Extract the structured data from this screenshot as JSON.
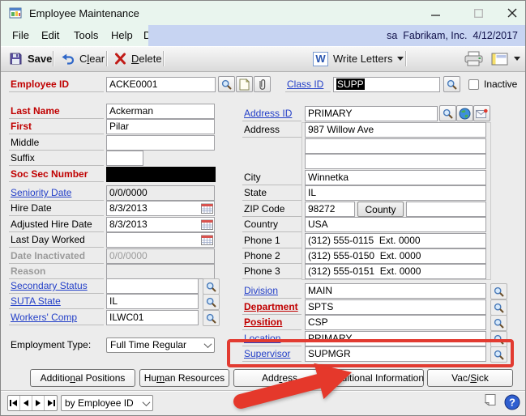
{
  "window": {
    "title": "Employee Maintenance"
  },
  "menubar": {
    "file": "File",
    "edit": "Edit",
    "tools": "Tools",
    "help": "Help",
    "debug": "Debug",
    "context": "sa  Fabrikam, Inc.  4/12/2017"
  },
  "toolbar": {
    "save": "Save",
    "clear_pre": "C",
    "clear_key": "l",
    "clear_post": "ear",
    "delete_pre": "",
    "delete_key": "D",
    "delete_post": "elete",
    "word_letter": "W",
    "write_letters": "Write Letters"
  },
  "header": {
    "employee_id_label": "Employee ID",
    "employee_id": "ACKE0001",
    "class_id_label": "Class ID",
    "class_id": "SUPP",
    "inactive_label": "Inactive"
  },
  "personal": {
    "last_name_label": "Last Name",
    "last_name": "Ackerman",
    "first_label": "First",
    "first": "Pilar",
    "middle_label": "Middle",
    "middle": "",
    "suffix_label": "Suffix",
    "suffix": "",
    "ssn_label": "Soc Sec Number"
  },
  "dates": {
    "seniority_label": "Seniority Date",
    "seniority": "0/0/0000",
    "hire_label": "Hire Date",
    "hire": "8/3/2013",
    "adjusted_label": "Adjusted Hire Date",
    "adjusted": "8/3/2013",
    "last_day_label": "Last Day Worked",
    "last_day": "",
    "inactivated_label": "Date Inactivated",
    "inactivated": "0/0/0000",
    "reason_label": "Reason",
    "reason": ""
  },
  "status": {
    "secondary_label": "Secondary Status",
    "secondary": "",
    "suta_label": "SUTA State",
    "suta": "IL",
    "workers_label": "Workers' Comp",
    "workers": "ILWC01",
    "employment_label": "Employment Type:",
    "employment": "Full Time Regular"
  },
  "address": {
    "address_id_label": "Address ID",
    "address_id": "PRIMARY",
    "address_label": "Address",
    "line1": "987 Willow Ave",
    "line2": "",
    "line3": "",
    "city_label": "City",
    "city": "Winnetka",
    "state_label": "State",
    "state": "IL",
    "zip_label": "ZIP Code",
    "zip": "98272",
    "county_button": "County",
    "county": "",
    "country_label": "Country",
    "country": "USA",
    "phone1_label": "Phone 1",
    "phone1": "(312) 555-0115  Ext. 0000",
    "phone2_label": "Phone 2",
    "phone2": "(312) 555-0150  Ext. 0000",
    "phone3_label": "Phone 3",
    "phone3": "(312) 555-0151  Ext. 0000"
  },
  "org": {
    "division_label": "Division",
    "division": "MAIN",
    "department_label": "Department",
    "department": "SPTS",
    "position_label": "Position",
    "position": "CSP",
    "location_label": "Location",
    "location": "PRIMARY",
    "supervisor_label": "Supervisor",
    "supervisor": "SUPMGR"
  },
  "footer": {
    "b1_pre": "Additio",
    "b1_key": "n",
    "b1_post": "al Positions",
    "b2_pre": "Hu",
    "b2_key": "m",
    "b2_post": "an Resources",
    "b3_pre": "Add",
    "b3_key": "r",
    "b3_post": "ess",
    "b4_pre": "",
    "b4_key": "A",
    "b4_post": "dditional Information",
    "b5_pre": "Vac/",
    "b5_key": "S",
    "b5_post": "ick"
  },
  "statusbar": {
    "sort_by": "by Employee ID"
  },
  "colors": {
    "annotation_red": "#e23b31",
    "required_red": "#c00000",
    "link_blue": "#2440c8"
  }
}
